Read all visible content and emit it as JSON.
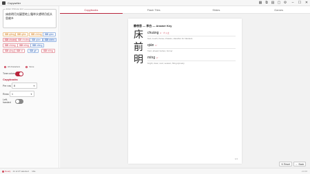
{
  "app": {
    "title": "Copywriter"
  },
  "titlebar_icons": [
    "grid-icon",
    "copy-icon",
    "archive-icon",
    "chat-icon",
    "settings-icon"
  ],
  "sidebar": {
    "textbox_label": "Enter Chinese text",
    "textbox_value": "床前明月光疑是地上霜举头望明月低头思故乡",
    "chips": [
      {
        "label": "qiāng",
        "icon": "⌨",
        "color": "orange",
        "selected": false
      },
      {
        "label": "qiān",
        "icon": "⌨",
        "color": "orange",
        "selected": false
      },
      {
        "label": "chōng",
        "icon": "⌨",
        "color": "orange",
        "selected": false
      },
      {
        "label": "qián",
        "icon": "⌨",
        "color": "blue",
        "selected": false
      },
      {
        "label": "chuáng",
        "icon": "⌨",
        "color": "pink",
        "selected": true
      },
      {
        "label": "chuāng",
        "icon": "⌨",
        "color": "pink",
        "selected": false
      },
      {
        "label": "qián",
        "icon": "⌨",
        "color": "blue",
        "selected": false
      },
      {
        "label": "shēn",
        "icon": "⌨",
        "color": "blue",
        "selected": true
      },
      {
        "label": "chǔng",
        "icon": "⌨",
        "color": "pink",
        "selected": false
      },
      {
        "label": "mīng",
        "icon": "⌨",
        "color": "pink",
        "selected": false
      },
      {
        "label": "xiōng",
        "icon": "⌨",
        "color": "blue",
        "selected": false
      },
      {
        "label": "qīng",
        "icon": "⌨",
        "color": "pink",
        "selected": false
      },
      {
        "label": "xī",
        "icon": "⌨",
        "color": "pink",
        "selected": false
      },
      {
        "label": "gē",
        "icon": "⌨",
        "color": "blue",
        "selected": false
      },
      {
        "label": "mīng",
        "icon": "⌨",
        "color": "pink",
        "selected": false
      }
    ],
    "radios": [
      {
        "label": "All characters",
        "on": false
      },
      {
        "label": "None",
        "on": false
      }
    ],
    "tone_colors_label": "Tone colors",
    "tone_colors_on": true,
    "section_title": "Copybooks",
    "per_row_label": "Per row",
    "per_row_value": "8",
    "rows_label": "Rows",
    "rows_value": "1",
    "left_handed_label": "Left-handed",
    "left_handed_on": false
  },
  "tabs": [
    {
      "label": "Copybooks",
      "active": true
    },
    {
      "label": "Flash Tiles",
      "active": false
    },
    {
      "label": "Slides",
      "active": false
    },
    {
      "label": "Games",
      "active": false
    }
  ],
  "card": {
    "title": "静夜思 — 李白 — Answer Key",
    "entries": [
      {
        "hanzi": "床",
        "pinyin": "chuáng",
        "tone": "2 ˊ ㄔㄨㄤ",
        "gloss": "bed; couch; frame; chassis; classifier for blankets"
      },
      {
        "hanzi": "前",
        "pinyin": "qián",
        "tone": "2 ˊ",
        "gloss": "front; ahead; before; former"
      },
      {
        "hanzi": "明",
        "pinyin": "míng",
        "tone": "2 ˊ",
        "gloss": "bright; clear; next; season; Ming dynasty"
      }
    ],
    "page_num": "1/4"
  },
  "buttons": {
    "reset": "Reset",
    "back": "Back"
  },
  "status": {
    "ready": "Ready",
    "selection": "21 of 27 selected",
    "mode": "Idle",
    "version": "v1.0.0"
  },
  "colors": {
    "accent": "#b8233b",
    "pink": "#d14a5c",
    "blue": "#3a6bbd",
    "orange": "#d8862a"
  }
}
